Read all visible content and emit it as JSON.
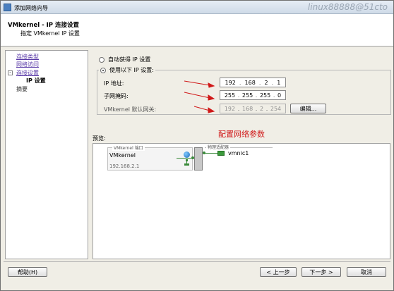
{
  "window": {
    "title": "添加网络向导",
    "watermark": "linux88888@51cto"
  },
  "header": {
    "title": "VMkernel - IP 连接设置",
    "subtitle": "指定 VMkernel IP 设置"
  },
  "nav": {
    "items": [
      {
        "label": "连接类型",
        "state": "link"
      },
      {
        "label": "网络访问",
        "state": "link"
      },
      {
        "label": "连接设置",
        "state": "link"
      },
      {
        "label": "IP 设置",
        "state": "current"
      },
      {
        "label": "摘要",
        "state": "plain"
      }
    ],
    "toggle": "-"
  },
  "ip_settings": {
    "auto_label": "自动获得 IP 设置",
    "manual_label": "使用以下 IP 设置:",
    "selected": "manual",
    "ip_label": "IP 地址:",
    "ip": [
      "192",
      "168",
      "2",
      "1"
    ],
    "mask_label": "子网掩码:",
    "mask": [
      "255",
      "255",
      "255",
      "0"
    ],
    "gateway_label": "VMkernel 默认网关:",
    "gateway": [
      "192",
      "168",
      "2",
      "254"
    ],
    "edit_button": "编辑...",
    "dot": "."
  },
  "annotation": {
    "text": "配置网络参数",
    "color": "#d01818"
  },
  "preview": {
    "label": "预览:",
    "vmkernel_port_label": "VMkernel 端口",
    "vmkernel_name": "VMkernel",
    "vmkernel_ip": "192.168.2.1",
    "physical_adapter_label": "物理适配器",
    "nic_name": "vmnic1"
  },
  "footer": {
    "help": "帮助(H)",
    "back": "< 上一步",
    "next": "下一步 >",
    "cancel": "取消"
  }
}
